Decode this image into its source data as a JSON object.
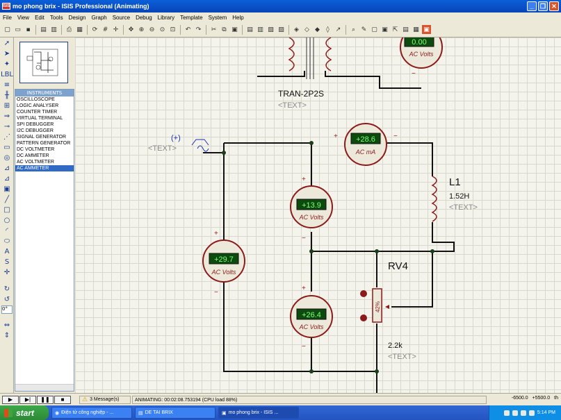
{
  "window": {
    "title": "mo phong brix - ISIS Professional (Animating)",
    "app_icon": "ISIS"
  },
  "menu": [
    "File",
    "View",
    "Edit",
    "Tools",
    "Design",
    "Graph",
    "Source",
    "Debug",
    "Library",
    "Template",
    "System",
    "Help"
  ],
  "device_panel": {
    "header": "INSTRUMENTS",
    "items": [
      "OSCILLOSCOPE",
      "LOGIC ANALYSER",
      "COUNTER TIMER",
      "VIRTUAL TERMINAL",
      "SPI DEBUGGER",
      "I2C DEBUGGER",
      "SIGNAL GENERATOR",
      "PATTERN GENERATOR",
      "DC VOLTMETER",
      "DC AMMETER",
      "AC VOLTMETER",
      "AC AMMETER"
    ],
    "selected_index": 11
  },
  "rotation_value": "0°",
  "schematic": {
    "transformer": {
      "name": "TRAN-2P2S",
      "text": "<TEXT>"
    },
    "source": {
      "symbol": "(+)",
      "text": "<TEXT>"
    },
    "inductor": {
      "name": "L1",
      "value": "1.52H",
      "text": "<TEXT>"
    },
    "pot": {
      "name": "RV4",
      "value": "2.2k",
      "text": "<TEXT>",
      "position": "42%"
    },
    "meters": {
      "m_top": {
        "reading": "0.00",
        "unit": "AC Volts"
      },
      "m_ammeter": {
        "reading": "+28.6",
        "unit": "AC mA"
      },
      "m_mid": {
        "reading": "+13.9",
        "unit": "AC Volts"
      },
      "m_left": {
        "reading": "+29.7",
        "unit": "AC Volts"
      },
      "m_low": {
        "reading": "+26.4",
        "unit": "AC Volts"
      }
    },
    "plus": "+",
    "minus": "−"
  },
  "status": {
    "messages": "3 Message(s)",
    "animating": "ANIMATING: 00:02:08.753194 (CPU load 88%)",
    "x": "-6500.0",
    "y": "+5500.0",
    "unit": "th"
  },
  "taskbar": {
    "start": "start",
    "tasks": [
      "Điện tử công nghiệp - ...",
      "DE TAI BRIX",
      "mo phong brix - ISIS ..."
    ],
    "time": "5:14 PM"
  }
}
